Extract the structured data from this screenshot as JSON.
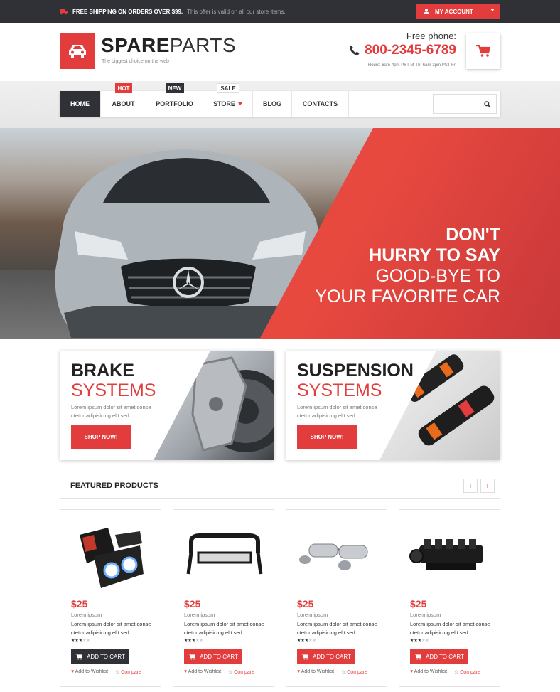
{
  "topbar": {
    "shipping_bold": "FREE SHIPPING ON ORDERS OVER $99.",
    "shipping_note": "This offer is valid on all our store items.",
    "account_label": "MY ACCOUNT"
  },
  "header": {
    "logo_bold": "SPARE",
    "logo_light": "PARTS",
    "tagline": "The biggest choice on the web",
    "free_phone_label": "Free phone:",
    "phone": "800-2345-6789",
    "hours": "Hours:  6am-4pm PST M-Th;  6am-3pm PST Fri"
  },
  "nav": {
    "items": [
      {
        "label": "HOME",
        "badge": ""
      },
      {
        "label": "ABOUT",
        "badge": "HOT"
      },
      {
        "label": "PORTFOLIO",
        "badge": "NEW"
      },
      {
        "label": "STORE",
        "badge": "SALE"
      },
      {
        "label": "BLOG",
        "badge": ""
      },
      {
        "label": "CONTACTS",
        "badge": ""
      }
    ],
    "search_placeholder": ""
  },
  "hero": {
    "line1": "DON'T",
    "line2": "HURRY TO SAY",
    "line3": "GOOD-BYE TO",
    "line4": "YOUR FAVORITE CAR"
  },
  "promos": [
    {
      "title": "BRAKE",
      "subtitle": "SYSTEMS",
      "desc": "Lorem ipsum dolor sit amet conse ctetur adipisicing elit sed.",
      "button": "SHOP NOW!"
    },
    {
      "title": "SUSPENSION",
      "subtitle": "SYSTEMS",
      "desc": "Lorem ipsum dolor sit amet conse ctetur adipisicing elit sed.",
      "button": "SHOP NOW!"
    }
  ],
  "featured": {
    "title": "FEATURED PRODUCTS",
    "prev": "‹",
    "next": "›"
  },
  "products": [
    {
      "price": "$25",
      "name": "Lorem ipsum",
      "desc": "Lorem ipsum dolor sit amet conse ctetur adipisicing elit sed.",
      "rating": 3,
      "cart": "ADD TO CART",
      "wishlist": "Add to Wishlist",
      "compare": "Compare",
      "image": "headlights"
    },
    {
      "price": "$25",
      "name": "Lorem ipsum",
      "desc": "Lorem ipsum dolor sit amet conse ctetur adipisicing elit sed.",
      "rating": 3,
      "cart": "ADD TO CART",
      "wishlist": "Add to Wishlist",
      "compare": "Compare",
      "image": "bull-bar"
    },
    {
      "price": "$25",
      "name": "Lorem ipsum",
      "desc": "Lorem ipsum dolor sit amet conse ctetur adipisicing elit sed.",
      "rating": 3,
      "cart": "ADD TO CART",
      "wishlist": "Add to Wishlist",
      "compare": "Compare",
      "image": "exhaust"
    },
    {
      "price": "$25",
      "name": "Lorem ipsum",
      "desc": "Lorem ipsum dolor sit amet conse ctetur adipisicing elit sed.",
      "rating": 3,
      "cart": "ADD TO CART",
      "wishlist": "Add to Wishlist",
      "compare": "Compare",
      "image": "intake-manifold"
    }
  ],
  "colors": {
    "accent": "#e23c3c",
    "dark": "#2f3136"
  }
}
